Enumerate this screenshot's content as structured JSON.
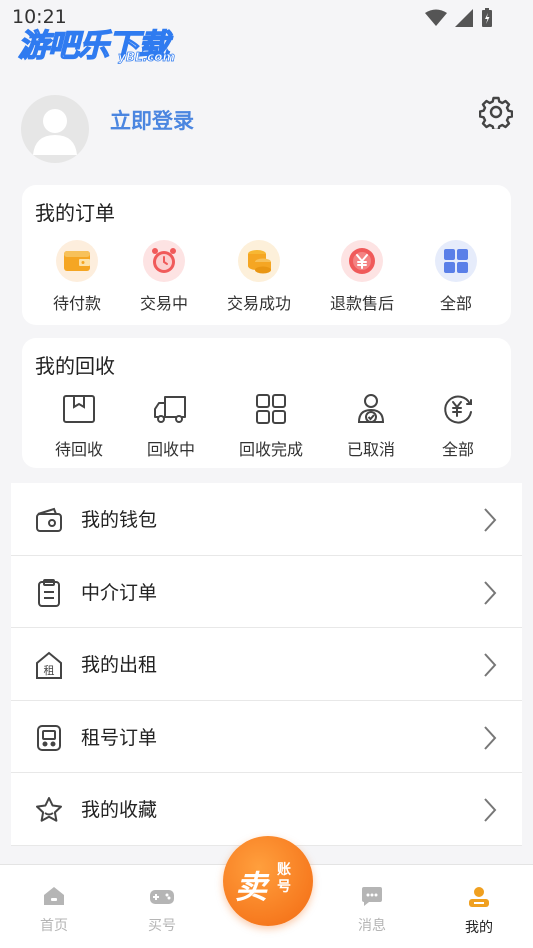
{
  "status_bar": {
    "time": "10:21"
  },
  "watermark": {
    "main": "游吧乐下载",
    "sub": "yBL.com"
  },
  "profile": {
    "login_label": "立即登录"
  },
  "orders": {
    "title": "我的订单",
    "items": [
      {
        "label": "待付款",
        "icon": "wallet-icon"
      },
      {
        "label": "交易中",
        "icon": "alarm-clock-icon"
      },
      {
        "label": "交易成功",
        "icon": "coins-icon"
      },
      {
        "label": "退款售后",
        "icon": "refund-yen-icon"
      },
      {
        "label": "全部",
        "icon": "grid-icon"
      }
    ]
  },
  "recycle": {
    "title": "我的回收",
    "items": [
      {
        "label": "待回收",
        "icon": "box-icon"
      },
      {
        "label": "回收中",
        "icon": "truck-icon"
      },
      {
        "label": "回收完成",
        "icon": "grid-outline-icon"
      },
      {
        "label": "已取消",
        "icon": "user-check-icon"
      },
      {
        "label": "全部",
        "icon": "yen-refresh-icon"
      }
    ]
  },
  "menu": [
    {
      "label": "我的钱包",
      "icon": "wallet-outline-icon"
    },
    {
      "label": "中介订单",
      "icon": "clipboard-icon"
    },
    {
      "label": "我的出租",
      "icon": "house-rent-icon"
    },
    {
      "label": "租号订单",
      "icon": "device-icon"
    },
    {
      "label": "我的收藏",
      "icon": "star-icon"
    }
  ],
  "tabbar": {
    "items": [
      {
        "label": "首页",
        "icon": "home-icon",
        "active": false
      },
      {
        "label": "买号",
        "icon": "gamepad-icon",
        "active": false
      },
      {
        "label": "消息",
        "icon": "message-icon",
        "active": false
      },
      {
        "label": "我的",
        "icon": "person-icon",
        "active": true
      }
    ],
    "sell_button": {
      "big": "卖",
      "small": "账号"
    }
  },
  "colors": {
    "accent": "#4b86e0",
    "orange": "#f36a12",
    "active_tab": "#f0a020"
  }
}
